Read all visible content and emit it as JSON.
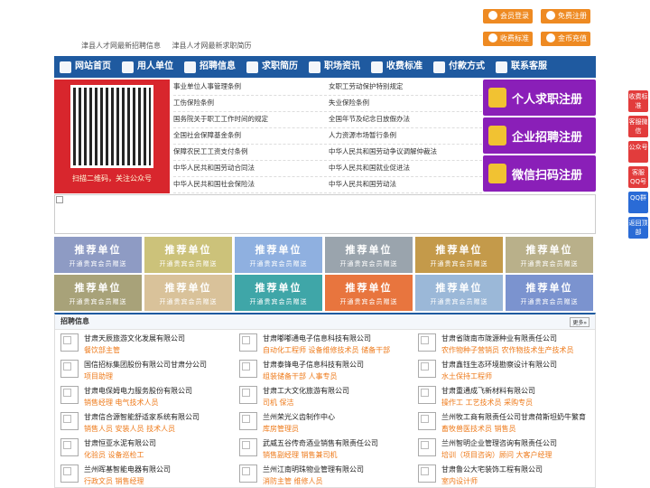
{
  "top_links": [
    "津县人才网最新招聘信息",
    "津县人才网最新求职简历"
  ],
  "top_buttons": [
    "会员登录",
    "免费注册",
    "收费标准",
    "金币充值"
  ],
  "nav": [
    "网站首页",
    "用人单位",
    "招聘信息",
    "求职简历",
    "职场资讯",
    "收费标准",
    "付款方式",
    "联系客服"
  ],
  "qr_caption": "扫描二维码，关注公众号",
  "laws_left": [
    "事业单位人事管理条例",
    "工伤保险条例",
    "国务院关于职工工作时间的规定",
    "全国社会保障基金条例",
    "保障农民工工资支付条例",
    "中华人民共和国劳动合同法",
    "中华人民共和国社会保险法"
  ],
  "laws_right": [
    "女职工劳动保护特别规定",
    "失业保险条例",
    "全国年节及纪念日放假办法",
    "人力资源市场暂行条例",
    "中华人民共和国劳动争议调解仲裁法",
    "中华人民共和国就业促进法",
    "中华人民共和国劳动法"
  ],
  "register": [
    "个人求职注册",
    "企业招聘注册",
    "微信扫码注册"
  ],
  "side": [
    "收费标准",
    "客服微信",
    "公众号",
    "客服QQ号",
    "QQ群",
    "返回顶部"
  ],
  "tile_title": "推荐单位",
  "tile_sub": "开通贵宾会员赠送",
  "tile_colors": [
    "#8e9bc4",
    "#ccc27a",
    "#8fb0e0",
    "#9aa4ad",
    "#c49a4a",
    "#b9b08a",
    "#a8a279",
    "#d9c29a",
    "#3fa6a8",
    "#e8753e",
    "#9bb8d8",
    "#7b93cf"
  ],
  "jobs_title": "招聘信息",
  "jobs_more": "更多»",
  "jobs": [
    {
      "c": "甘肃天辰旅游文化发展有限公司",
      "j": "餐饮部主管"
    },
    {
      "c": "甘肃嘟嘟通电子信息科技有限公司",
      "j": "自动化工程师 设备维修技术员 储备干部"
    },
    {
      "c": "甘肃省陇南市陇源种业有限责任公司",
      "j": "农作物种子营销员 农作物技术生产技术员"
    },
    {
      "c": "国信招标集团股份有限公司甘肃分公司",
      "j": "项目助理"
    },
    {
      "c": "甘肃泰锋电子信息科技有限公司",
      "j": "组装储备干部 人事专员"
    },
    {
      "c": "甘肃鑫钰生态环境勘察设计有限公司",
      "j": "水土保持工程师"
    },
    {
      "c": "甘肃电保姆电力服务股份有限公司",
      "j": "销售经理 电气技术人员"
    },
    {
      "c": "甘肃工大文化旅游有限公司",
      "j": "司机 保洁"
    },
    {
      "c": "甘肃重通成飞新材料有限公司",
      "j": "操作工 工艺技术员 采购专员"
    },
    {
      "c": "甘肃信合源智能舒适家系统有限公司",
      "j": "销售人员 安装人员 技术人员"
    },
    {
      "c": "兰州荣光义齿制作中心",
      "j": "库房管理员"
    },
    {
      "c": "兰州牧工商有限责任公司甘肃荷斯坦奶牛繁育",
      "j": "畜牧兽医技术员 销售员"
    },
    {
      "c": "甘肃恒亚水泥有限公司",
      "j": "化验员 设备巡检工"
    },
    {
      "c": "武威五谷传奇酒业销售有限责任公司",
      "j": "销售副经理 销售兼司机"
    },
    {
      "c": "兰州智明企业管理咨询有限责任公司",
      "j": "培训（项目咨询）顾问 大客户经理"
    },
    {
      "c": "兰州晖基智能电器有限公司",
      "j": "行政文员 销售经理"
    },
    {
      "c": "兰州江南明珠物业管理有限公司",
      "j": "消防主管 维修人员"
    },
    {
      "c": "甘肃鲁公大宅装饰工程有限公司",
      "j": "室内设计师"
    }
  ]
}
